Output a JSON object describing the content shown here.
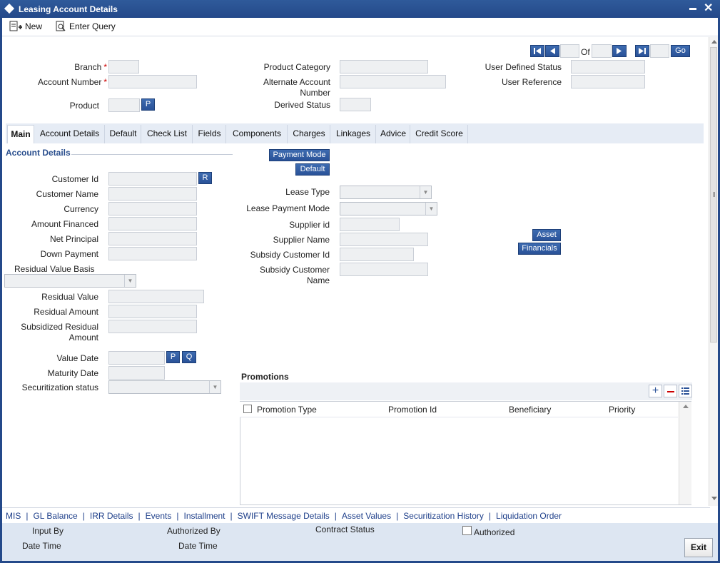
{
  "window": {
    "title": "Leasing Account Details",
    "min_glyph": "▬",
    "close_glyph": "✕"
  },
  "toolbar": {
    "new_label": "New",
    "enter_query_label": "Enter Query"
  },
  "navigation": {
    "of_label": "Of",
    "go_label": "Go"
  },
  "header": {
    "branch_label": "Branch",
    "account_number_label": "Account Number",
    "product_label": "Product",
    "product_button": "P",
    "product_category_label": "Product Category",
    "alternate_account_label_1": "Alternate Account",
    "alternate_account_label_2": "Number",
    "derived_status_label": "Derived Status",
    "user_defined_status_label": "User Defined Status",
    "user_reference_label": "User Reference",
    "required_marker": "*"
  },
  "tabs": [
    {
      "label": "Main",
      "active": true
    },
    {
      "label": "Account Details"
    },
    {
      "label": "Default"
    },
    {
      "label": "Check List"
    },
    {
      "label": "Fields"
    },
    {
      "label": "Components"
    },
    {
      "label": "Charges"
    },
    {
      "label": "Linkages"
    },
    {
      "label": "Advice"
    },
    {
      "label": "Credit Score"
    }
  ],
  "main": {
    "section_title": "Account Details",
    "payment_mode_button": "Payment Mode",
    "default_button": "Default",
    "customer_id_label": "Customer Id",
    "customer_id_button": "R",
    "customer_name_label": "Customer Name",
    "currency_label": "Currency",
    "amount_financed_label": "Amount Financed",
    "net_principal_label": "Net Principal",
    "down_payment_label": "Down Payment",
    "residual_value_basis_label": "Residual Value Basis",
    "residual_value_label": "Residual Value",
    "residual_amount_label": "Residual Amount",
    "subsidized_residual_label_1": "Subsidized Residual",
    "subsidized_residual_label_2": "Amount",
    "value_date_label": "Value Date",
    "value_date_p": "P",
    "value_date_q": "Q",
    "maturity_date_label": "Maturity Date",
    "securitization_status_label": "Securitization status",
    "lease_type_label": "Lease Type",
    "lease_payment_mode_label": "Lease Payment Mode",
    "supplier_id_label": "Supplier id",
    "supplier_name_label": "Supplier Name",
    "subsidy_customer_id_label": "Subsidy Customer Id",
    "subsidy_customer_name_label_1": "Subsidy Customer",
    "subsidy_customer_name_label_2": "Name",
    "asset_button": "Asset",
    "financials_button": "Financials"
  },
  "promotions": {
    "title": "Promotions",
    "columns": [
      "Promotion Type",
      "Promotion Id",
      "Beneficiary",
      "Priority"
    ]
  },
  "footer_links": [
    "MIS",
    "GL Balance",
    "IRR Details",
    "Events",
    "Installment",
    "SWIFT Message Details",
    "Asset Values",
    "Securitization History",
    "Liquidation Order"
  ],
  "footer_separator": "|",
  "footer": {
    "input_by": "Input By",
    "date_time_1": "Date Time",
    "authorized_by": "Authorized By",
    "date_time_2": "Date Time",
    "contract_status": "Contract Status",
    "authorized": "Authorized",
    "exit": "Exit"
  },
  "colors": {
    "titlebar": "#24498a",
    "button": "#2a5298",
    "link": "#1e3f8a",
    "tabbar": "#e6ecf5"
  }
}
